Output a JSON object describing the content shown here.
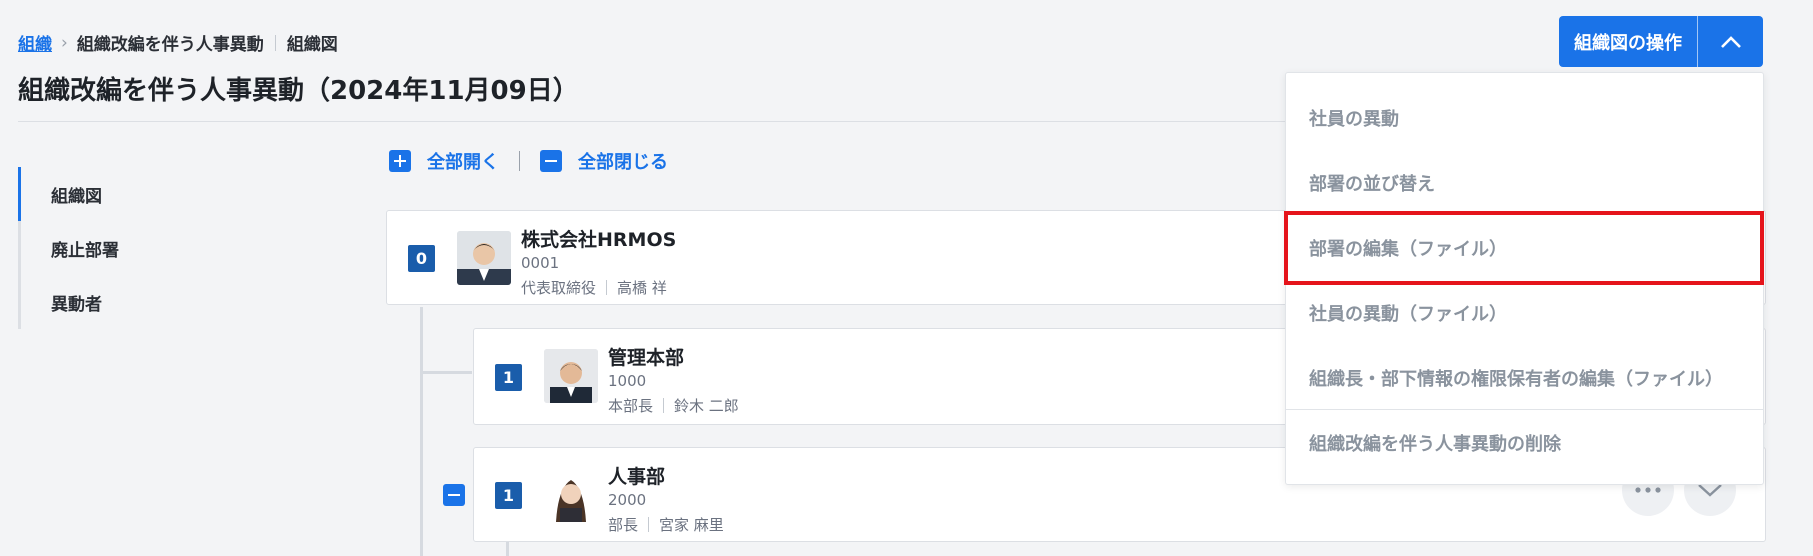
{
  "breadcrumb": {
    "root": "組織",
    "current": "組織改編を伴う人事異動",
    "sub": "組織図"
  },
  "page_title": "組織改編を伴う人事異動（2024年11月09日）",
  "sidenav": {
    "items": [
      {
        "label": "組織図",
        "active": true
      },
      {
        "label": "廃止部署",
        "active": false
      },
      {
        "label": "異動者",
        "active": false
      }
    ]
  },
  "toolbar": {
    "expand_all": "全部開く",
    "collapse_all": "全部閉じる"
  },
  "ops_button": {
    "label": "組織図の操作",
    "toggle_icon": "chevron-up-icon"
  },
  "dropdown": {
    "items": [
      {
        "label": "社員の異動"
      },
      {
        "label": "部署の並び替え"
      },
      {
        "label": "部署の編集（ファイル）",
        "highlighted": true
      },
      {
        "label": "社員の異動（ファイル）"
      },
      {
        "label": "組織長・部下情報の権限保有者の編集（ファイル）"
      },
      {
        "label": "組織改編を伴う人事異動の削除"
      }
    ]
  },
  "tree": {
    "nodes": [
      {
        "count": "0",
        "name": "株式会社HRMOS",
        "code": "0001",
        "role": "代表取締役",
        "person": "高橋 祥"
      },
      {
        "count": "1",
        "name": "管理本部",
        "code": "1000",
        "role": "本部長",
        "person": "鈴木 二郎"
      },
      {
        "count": "1",
        "name": "人事部",
        "code": "2000",
        "role": "部長",
        "person": "宮家 麻里"
      }
    ]
  },
  "colors": {
    "primary": "#1a73e8",
    "badge": "#1a5dab",
    "highlight": "#e5141b",
    "menu_text": "#8a939e"
  }
}
